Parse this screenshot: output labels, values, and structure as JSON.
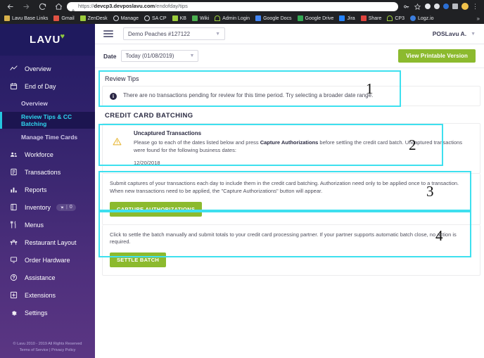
{
  "browser": {
    "url_secure": "https://",
    "url_host": "devcp3.devposlavu.com",
    "url_path": "/endofday/tips",
    "back_icon": "back-arrow-icon",
    "forward_icon": "forward-arrow-icon",
    "reload_icon": "reload-icon",
    "home_icon": "home-icon",
    "lock_icon": "lock-icon",
    "bookmark_star_icon": "star-icon",
    "menu_icon": "kebab-menu-icon",
    "bookmarks": [
      {
        "label": "Lavu Base Links",
        "color": "#d8b24a",
        "icon": "folder-icon"
      },
      {
        "label": "Gmail",
        "color": "#e05243",
        "icon": "gmail-icon"
      },
      {
        "label": "ZenDesk",
        "color": "#9ccc3c",
        "icon": "zendesk-icon"
      },
      {
        "label": "Manage",
        "color": "#dfe3e8",
        "icon": "manage-icon"
      },
      {
        "label": "SA CP",
        "color": "#dfe3e8",
        "icon": "sacp-icon"
      },
      {
        "label": "KB",
        "color": "#9ccc3c",
        "icon": "kb-icon"
      },
      {
        "label": "Wiki",
        "color": "#4caf50",
        "icon": "wiki-icon"
      },
      {
        "label": "Admin Login",
        "color": "#9ccc3c",
        "icon": "admin-login-icon"
      },
      {
        "label": "Google Docs",
        "color": "#4285f4",
        "icon": "google-docs-icon"
      },
      {
        "label": "Google Drive",
        "color": "#34a853",
        "icon": "google-drive-icon"
      },
      {
        "label": "Jira",
        "color": "#2684ff",
        "icon": "jira-icon"
      },
      {
        "label": "Share",
        "color": "#e0443e",
        "icon": "share-icon"
      },
      {
        "label": "CP3",
        "color": "#9ccc3c",
        "icon": "cp3-icon"
      },
      {
        "label": "Logz.io",
        "color": "#3b7ddd",
        "icon": "logz-icon"
      }
    ],
    "overflow": "»"
  },
  "sidebar": {
    "logo": "LAVU",
    "heart_icon": "heart-icon",
    "items": [
      {
        "label": "Overview",
        "icon": "chart-line-icon",
        "type": "item"
      },
      {
        "label": "End of Day",
        "icon": "calendar-icon",
        "type": "item"
      },
      {
        "label": "Overview",
        "type": "sub",
        "active": false
      },
      {
        "label": "Review Tips & CC Batching",
        "type": "sub",
        "active": true
      },
      {
        "label": "Manage Time Cards",
        "type": "sub",
        "active": false
      },
      {
        "label": "Workforce",
        "icon": "people-icon",
        "type": "item"
      },
      {
        "label": "Transactions",
        "icon": "receipt-icon",
        "type": "item"
      },
      {
        "label": "Reports",
        "icon": "bar-chart-icon",
        "type": "item"
      },
      {
        "label": "Inventory",
        "icon": "box-icon",
        "type": "item",
        "badge": "0",
        "badge_icon": "cart-icon"
      },
      {
        "label": "Menus",
        "icon": "cutlery-icon",
        "type": "item"
      },
      {
        "label": "Restaurant Layout",
        "icon": "table-seats-icon",
        "type": "item"
      },
      {
        "label": "Order Hardware",
        "icon": "monitor-icon",
        "type": "item"
      },
      {
        "label": "Assistance",
        "icon": "question-circle-icon",
        "type": "item"
      },
      {
        "label": "Extensions",
        "icon": "plus-square-icon",
        "type": "item"
      },
      {
        "label": "Settings",
        "icon": "gear-icon",
        "type": "item"
      }
    ],
    "footer_line1": "© Lavu 2010 - 2019   All Rights Reserved",
    "footer_line2": "Terms of Service | Privacy Policy"
  },
  "topbar": {
    "menu_icon": "hamburger-menu-icon",
    "store": "Demo Peaches #127122",
    "store_chevron_icon": "chevron-down-icon",
    "user": "POSLavu A.",
    "user_chevron_icon": "chevron-down-icon"
  },
  "daterow": {
    "label": "Date",
    "value": "Today (01/08/2019)",
    "chevron_icon": "chevron-down-icon",
    "print_button": "View Printable Version"
  },
  "review_tips": {
    "title": "Review Tips",
    "info_icon": "info-circle-icon",
    "message": "There are no transactions pending for review for this time period. Try selecting a broader date range."
  },
  "cc_batching": {
    "title": "CREDIT CARD BATCHING",
    "warning": {
      "icon": "warning-triangle-icon",
      "heading": "Uncaptured Transactions",
      "body_part1": "Please go to each of the dates listed below and press ",
      "body_bold": "Capture Authorizations",
      "body_part2": " before settling the credit card batch. Uncaptured transactions were found for the following business dates:",
      "date": "12/20/2018"
    },
    "capture_card": {
      "text": "Submit captures of your transactions each day to include them in the credit card batching. Authorization need only to be applied once to a transaction. When new transactions need to be applied, the \"Capture Authorizations\" button will appear.",
      "button": "CAPTURE AUTHORIZATIONS"
    },
    "settle_card": {
      "text": "Click to settle the batch manually and submit totals to your credit card processing partner. If your partner supports automatic batch close, no action is required.",
      "button": "SETTLE BATCH"
    }
  },
  "annotations": {
    "accent_color": "#3ee0ef",
    "numbers": [
      "1",
      "2",
      "3",
      "4"
    ]
  }
}
